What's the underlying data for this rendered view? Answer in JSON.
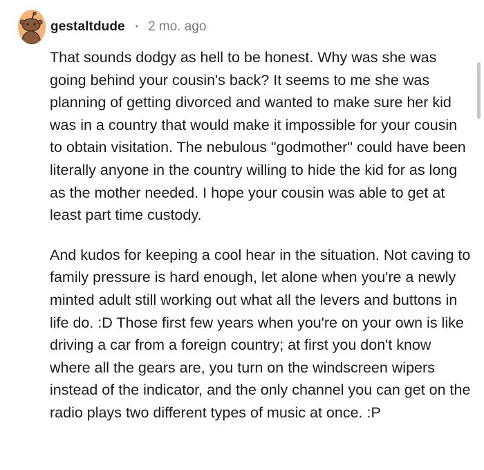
{
  "comment": {
    "username": "gestaltdude",
    "separator": "•",
    "timestamp": "2 mo. ago",
    "avatar_icon": "reddit-snoo-avatar-icon",
    "avatar_color": "#f4b27a",
    "paragraphs": [
      "That sounds dodgy as hell to be honest. Why was she was going behind your cousin's back? It seems to me she was planning of getting divorced and wanted to make sure her kid was in a country that would make it impossible for your cousin to obtain visitation. The nebulous \"godmother\" could have been literally anyone in the country willing to hide the kid for as long as the mother needed. I hope your cousin was able to get at least part time custody.",
      "And kudos for keeping a cool hear in the situation. Not caving to family pressure is hard enough, let alone when you're a newly minted adult still working out what all the levers and buttons in life do. :D Those first few years when you're on your own is like driving a car from a foreign country; at first you don't know where all the gears are, you turn on the windscreen wipers instead of the indicator, and the only channel you can get on the radio plays two different types of music at once. :P"
    ]
  }
}
